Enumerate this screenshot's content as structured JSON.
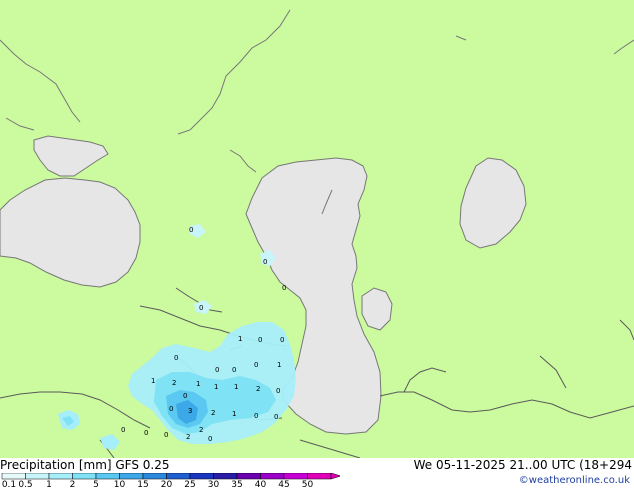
{
  "title": "Precipitation [mm]  GFS 0.25",
  "datetime": "We 05-11-2025 21..00 UTC (18+294",
  "credit": "©weatheronline.co.uk",
  "legend": {
    "labels": [
      "0.1",
      "0.5",
      "1",
      "2",
      "5",
      "10",
      "15",
      "20",
      "25",
      "30",
      "35",
      "40",
      "45",
      "50"
    ],
    "colors": [
      "#e6fafa",
      "#c8f5fa",
      "#a6eefa",
      "#7fe2f5",
      "#5ac8f0",
      "#3ca8e8",
      "#2a88dd",
      "#1f5fd0",
      "#1a36c0",
      "#2a1ea8",
      "#6a00b0",
      "#9a00c8",
      "#c800d8",
      "#e000b8"
    ]
  },
  "colors": {
    "land": "#ccfa9e",
    "water": "#e6e6e6",
    "coast": "#777777",
    "border": "#5a5a5a"
  },
  "precip_values": [
    "0",
    "0",
    "0",
    "0",
    "0",
    "0",
    "0",
    "1",
    "0",
    "1",
    "2",
    "1",
    "1",
    "2",
    "1",
    "1",
    "0",
    "0",
    "0",
    "2",
    "3",
    "2",
    "1",
    "0",
    "0",
    "0",
    "0",
    "0",
    "2",
    "0",
    "0",
    "0"
  ]
}
